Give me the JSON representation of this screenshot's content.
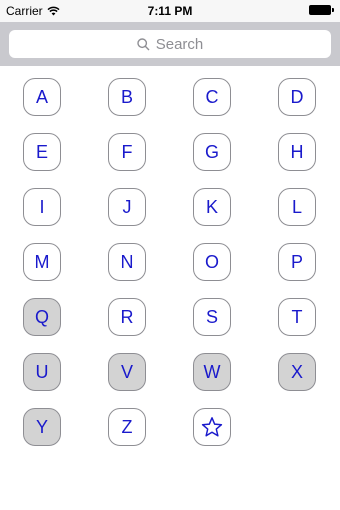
{
  "status_bar": {
    "carrier": "Carrier",
    "time": "7:11 PM"
  },
  "search": {
    "placeholder": "Search"
  },
  "keys": [
    {
      "label": "A",
      "selected": false
    },
    {
      "label": "B",
      "selected": false
    },
    {
      "label": "C",
      "selected": false
    },
    {
      "label": "D",
      "selected": false
    },
    {
      "label": "E",
      "selected": false
    },
    {
      "label": "F",
      "selected": false
    },
    {
      "label": "G",
      "selected": false
    },
    {
      "label": "H",
      "selected": false
    },
    {
      "label": "I",
      "selected": false
    },
    {
      "label": "J",
      "selected": false
    },
    {
      "label": "K",
      "selected": false
    },
    {
      "label": "L",
      "selected": false
    },
    {
      "label": "M",
      "selected": false
    },
    {
      "label": "N",
      "selected": false
    },
    {
      "label": "O",
      "selected": false
    },
    {
      "label": "P",
      "selected": false
    },
    {
      "label": "Q",
      "selected": true
    },
    {
      "label": "R",
      "selected": false
    },
    {
      "label": "S",
      "selected": false
    },
    {
      "label": "T",
      "selected": false
    },
    {
      "label": "U",
      "selected": true
    },
    {
      "label": "V",
      "selected": true
    },
    {
      "label": "W",
      "selected": true
    },
    {
      "label": "X",
      "selected": true
    },
    {
      "label": "Y",
      "selected": true
    },
    {
      "label": "Z",
      "selected": false
    },
    {
      "label": "☆",
      "selected": false,
      "icon": "star-icon"
    }
  ]
}
